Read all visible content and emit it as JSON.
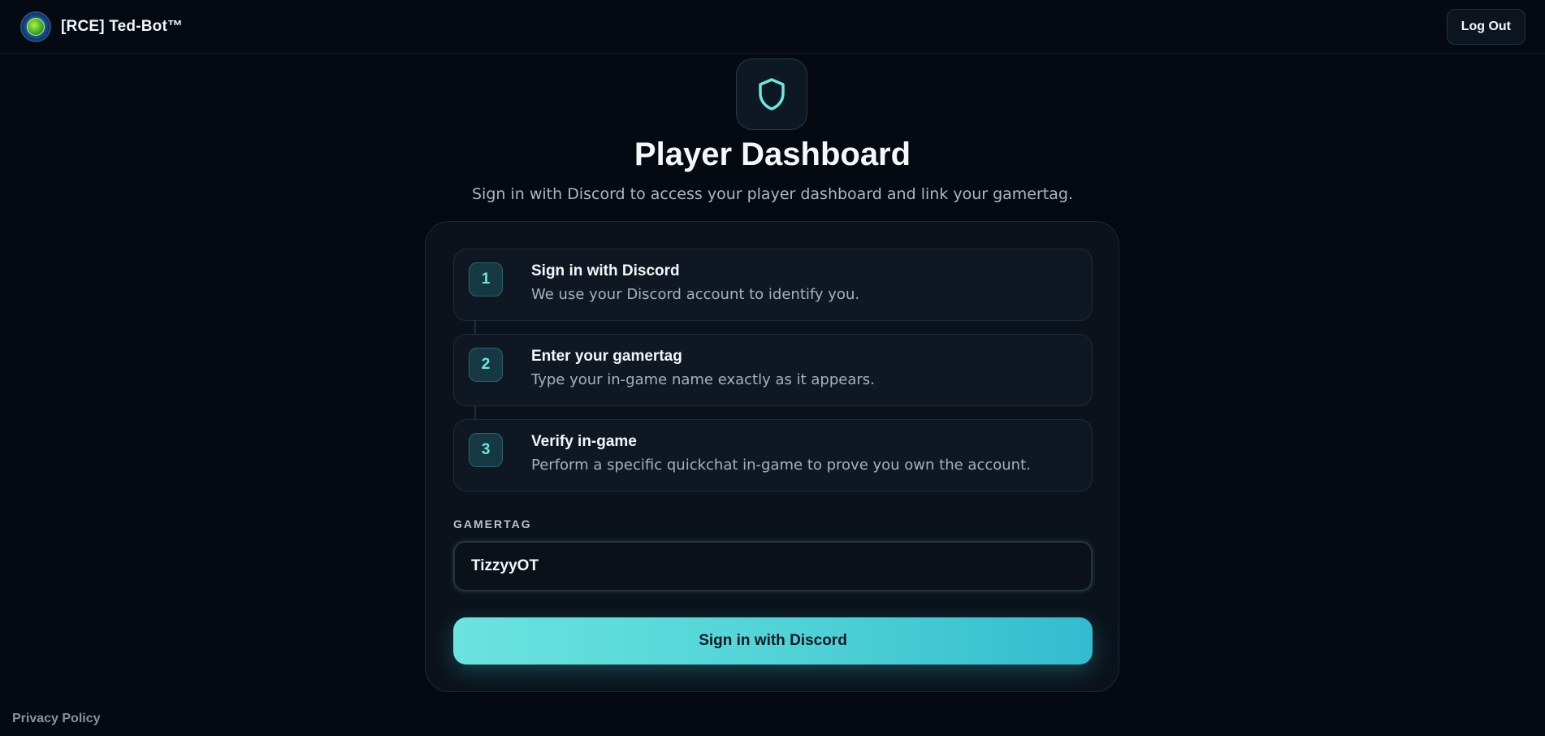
{
  "header": {
    "brand_name": "[RCE] Ted-Bot™",
    "logout_label": "Log Out"
  },
  "hero": {
    "icon": "shield-icon",
    "title": "Player Dashboard",
    "subtitle": "Sign in with Discord to access your player dashboard and link your gamertag."
  },
  "steps": [
    {
      "number": "1",
      "title": "Sign in with Discord",
      "description": "We use your Discord account to identify you."
    },
    {
      "number": "2",
      "title": "Enter your gamertag",
      "description": "Type your in-game name exactly as it appears."
    },
    {
      "number": "3",
      "title": "Verify in-game",
      "description": "Perform a specific quickchat in-game to prove you own the account."
    }
  ],
  "form": {
    "gamertag_label": "GAMERTAG",
    "gamertag_value": "TizzyyOT",
    "submit_label": "Sign in with Discord"
  },
  "footer": {
    "privacy_label": "Privacy Policy"
  },
  "colors": {
    "background": "#050a12",
    "accent": "#4fd2d6",
    "accent_text": "#6ee6e0"
  }
}
